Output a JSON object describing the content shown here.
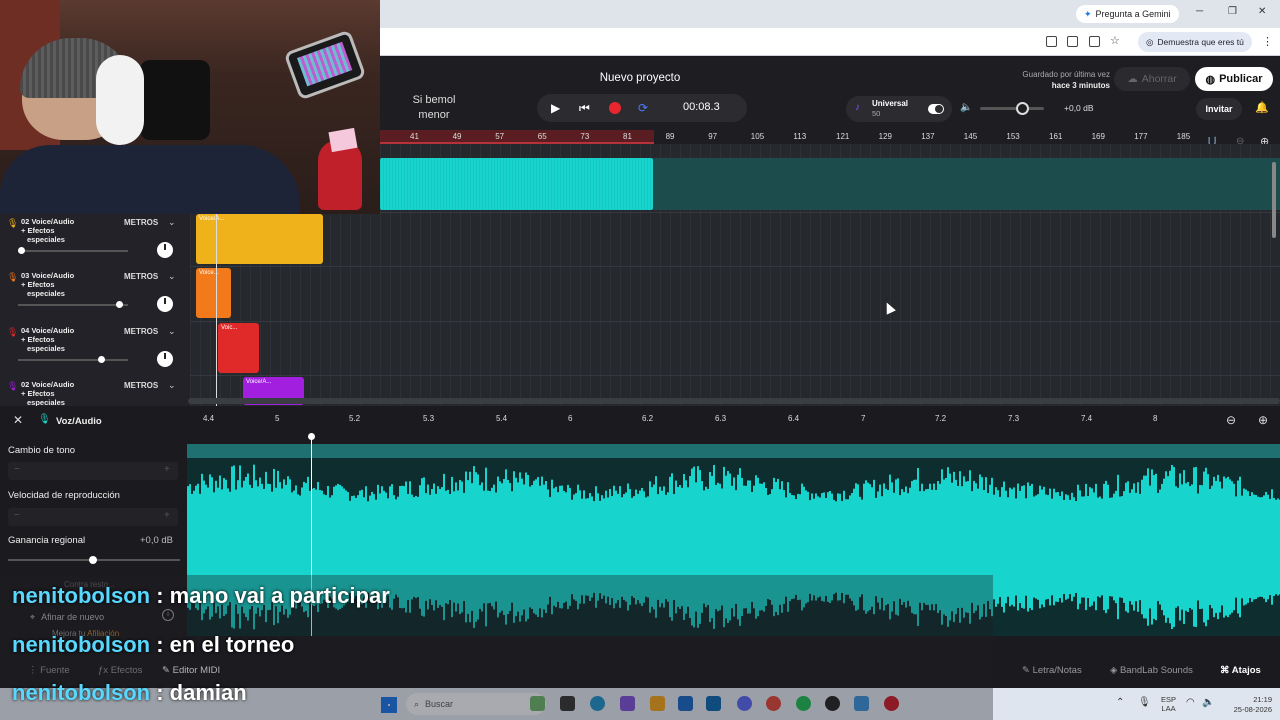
{
  "browser": {
    "gemini_label": "Pregunta a Gemini",
    "verify_chip": "Demuestra que eres tú"
  },
  "header": {
    "project_title": "Nuevo proyecto",
    "key_label": "Si bemol menor",
    "time": "00:08.3",
    "universal_title": "Universal",
    "universal_value": "50",
    "volume_db": "+0,0 dB",
    "saved_line1": "Guardado por última vez",
    "saved_line2": "hace 3 minutos",
    "save_label": "Ahorrar",
    "publish_label": "Publicar",
    "invite_label": "Invitar"
  },
  "ruler": [
    "41",
    "49",
    "57",
    "65",
    "73",
    "81",
    "89",
    "97",
    "105",
    "113",
    "121",
    "129",
    "137",
    "145",
    "153",
    "161",
    "169",
    "177",
    "185"
  ],
  "tracks": [
    {
      "number": "02",
      "name": "Voice/Audio",
      "effects": "+ Efectos",
      "effects2": "especiales",
      "meters": "METROS",
      "clip": "Voice/A...",
      "color": "#f0b21b",
      "level": 0.0
    },
    {
      "number": "03",
      "name": "Voice/Audio",
      "effects": "+ Efectos",
      "effects2": "especiales",
      "meters": "METROS",
      "clip": "Voice...",
      "color": "#f27a1a",
      "level": 0.95
    },
    {
      "number": "04",
      "name": "Voice/Audio",
      "effects": "+ Efectos",
      "effects2": "especiales",
      "meters": "METROS",
      "clip": "Voic...",
      "color": "#e02a2a",
      "level": 0.78
    },
    {
      "number": "02",
      "name": "Voice/Audio",
      "effects": "+ Efectos",
      "effects2": "especiales",
      "meters": "METROS",
      "clip": "Voice/A...",
      "color": "#a21fe0",
      "level": 0.5
    }
  ],
  "editor": {
    "title": "Voz/Audio",
    "pitch_label": "Cambio de tono",
    "speed_label": "Velocidad de reproducción",
    "gain_label": "Ganancia regional",
    "gain_value": "+0,0 dB",
    "faded_text": "Contra resto...",
    "retune_label": "Afinar de nuevo",
    "upgrade_text": "Mejora tu",
    "upgrade_link": "Afiliación",
    "ruler": [
      "4.4",
      "5",
      "5.2",
      "5.3",
      "5.4",
      "6",
      "6.2",
      "6.3",
      "6.4",
      "7",
      "7.2",
      "7.3",
      "7.4",
      "8"
    ]
  },
  "bottom_tabs": {
    "source": "Fuente",
    "effects": "Efectos",
    "midi": "Editor MIDI",
    "lyrics": "Letra/Notas",
    "sounds": "BandLab Sounds",
    "shortcuts": "Atajos"
  },
  "taskbar": {
    "search_placeholder": "Buscar",
    "lang1": "ESP",
    "lang2": "LAA",
    "time": "21:19",
    "date": "25-08-2026"
  },
  "chat": [
    {
      "user": "nenitobolson",
      "message": "mano vai a participar"
    },
    {
      "user": "nenitobolson",
      "message": "en el torneo"
    },
    {
      "user": "nenitobolson",
      "message": "damian"
    }
  ],
  "colors": {
    "accent": "#17d4cd",
    "record": "#e8262d",
    "chat_user": "#58d8ff"
  }
}
